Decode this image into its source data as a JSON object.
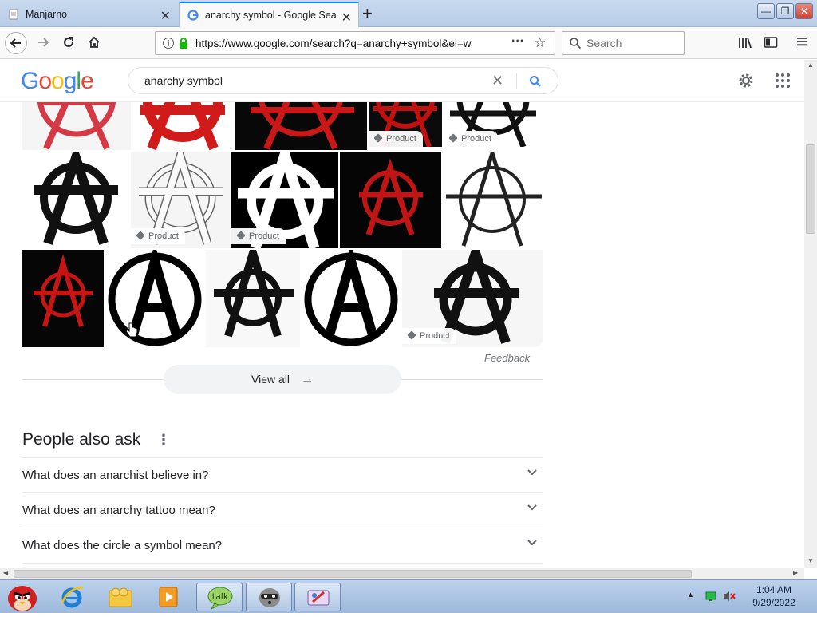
{
  "browser": {
    "tabs": [
      {
        "title": "Manjarno",
        "active": false
      },
      {
        "title": "anarchy symbol - Google Search",
        "active": true
      }
    ],
    "url": "https://www.google.com/search?q=anarchy+symbol&ei=w",
    "search_placeholder": "Search"
  },
  "google": {
    "logo_letters": [
      "G",
      "o",
      "o",
      "g",
      "l",
      "e"
    ],
    "logo_colors": [
      "#4285f4",
      "#ea4335",
      "#fbbc05",
      "#4285f4",
      "#34a853",
      "#ea4335"
    ],
    "query": "anarchy symbol"
  },
  "images": {
    "product_label": "Product",
    "feedback_label": "Feedback",
    "view_all_label": "View all"
  },
  "people_also_ask": {
    "title": "People also ask",
    "questions": [
      "What does an anarchist believe in?",
      "What does an anarchy tattoo mean?",
      "What does the circle a symbol mean?"
    ]
  },
  "taskbar": {
    "time": "1:04 AM",
    "date": "9/29/2022"
  },
  "colors": {
    "accent_blue": "#1a73e8",
    "symbol_red": "#d11a1a",
    "symbol_black": "#111111"
  }
}
